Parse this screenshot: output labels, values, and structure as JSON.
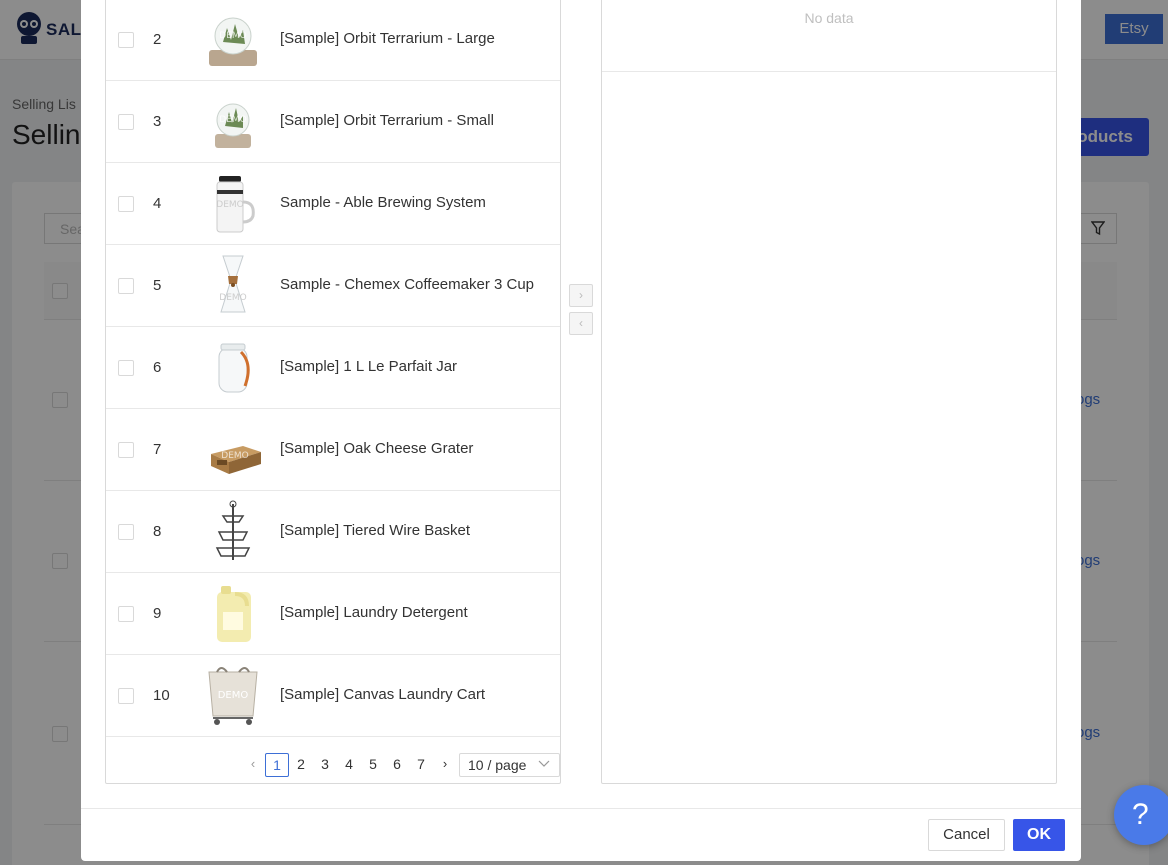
{
  "app": {
    "logo_text": "SALE",
    "channel_partial": "y",
    "channel_active": "Etsy",
    "breadcrumb": "Selling Lis",
    "page_title": "Sellin",
    "products_button": "roducts",
    "search_placeholder": "Sea",
    "row_links": [
      "ogs",
      "ogs",
      "ogs"
    ]
  },
  "modal": {
    "left_rows": [
      {
        "num": "2",
        "name": "[Sample] Orbit Terrarium - Large",
        "thumb": "terrarium-large"
      },
      {
        "num": "3",
        "name": "[Sample] Orbit Terrarium - Small",
        "thumb": "terrarium-small"
      },
      {
        "num": "4",
        "name": "Sample - Able Brewing System",
        "thumb": "brewing-system"
      },
      {
        "num": "5",
        "name": "Sample - Chemex Coffeemaker 3 Cup",
        "thumb": "chemex"
      },
      {
        "num": "6",
        "name": "[Sample] 1 L Le Parfait Jar",
        "thumb": "parfait-jar"
      },
      {
        "num": "7",
        "name": "[Sample] Oak Cheese Grater",
        "thumb": "cheese-grater"
      },
      {
        "num": "8",
        "name": "[Sample] Tiered Wire Basket",
        "thumb": "wire-basket"
      },
      {
        "num": "9",
        "name": "[Sample] Laundry Detergent",
        "thumb": "detergent"
      },
      {
        "num": "10",
        "name": "[Sample] Canvas Laundry Cart",
        "thumb": "laundry-cart"
      }
    ],
    "thumb_watermark": "DEMO",
    "pagination": {
      "prev": "‹",
      "next": "›",
      "pages": [
        "1",
        "2",
        "3",
        "4",
        "5",
        "6",
        "7"
      ],
      "current": "1",
      "page_size": "10 / page"
    },
    "move_right": "›",
    "move_left": "‹",
    "right_empty": "No data",
    "cancel_label": "Cancel",
    "ok_label": "OK"
  },
  "help_label": "?",
  "colors": {
    "primary": "#3755e8",
    "link": "#3d6fd6",
    "mask": "rgba(0,0,0,0.45)"
  }
}
